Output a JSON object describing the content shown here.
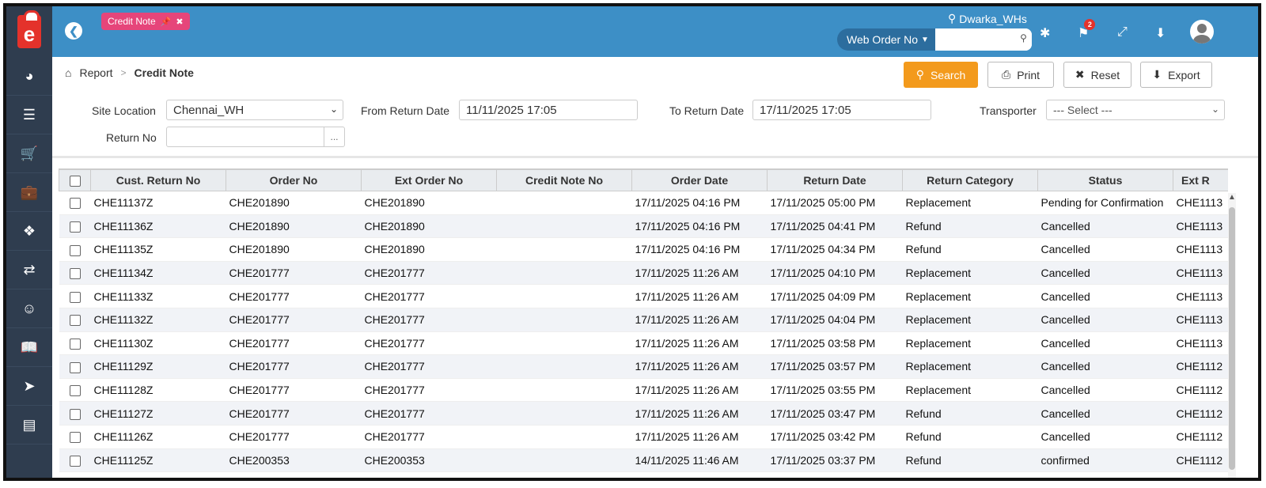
{
  "header": {
    "tab_label": "Credit Note",
    "location": "Dwarka_WHs",
    "search_type": "Web Order No",
    "search_placeholder": "",
    "notification_count": "2",
    "logo_letter": "e"
  },
  "breadcrumb": {
    "root": "Report",
    "current": "Credit Note"
  },
  "actions": {
    "search": "Search",
    "print": "Print",
    "reset": "Reset",
    "export": "Export"
  },
  "filters": {
    "site_location_label": "Site Location",
    "site_location_value": "Chennai_WH",
    "from_date_label": "From Return Date",
    "from_date_value": "11/11/2025 17:05",
    "to_date_label": "To Return Date",
    "to_date_value": "17/11/2025 17:05",
    "transporter_label": "Transporter",
    "transporter_value": "--- Select ---",
    "return_no_label": "Return No",
    "return_no_value": "",
    "return_no_button": "..."
  },
  "table": {
    "columns": [
      "Cust. Return No",
      "Order No",
      "Ext Order No",
      "Credit Note No",
      "Order Date",
      "Return Date",
      "Return Category",
      "Status",
      "Ext R"
    ],
    "rows": [
      [
        "CHE11137Z",
        "CHE201890",
        "CHE201890",
        "",
        "17/11/2025 04:16 PM",
        "17/11/2025 05:00 PM",
        "Replacement",
        "Pending for Confirmation",
        "CHE1113"
      ],
      [
        "CHE11136Z",
        "CHE201890",
        "CHE201890",
        "",
        "17/11/2025 04:16 PM",
        "17/11/2025 04:41 PM",
        "Refund",
        "Cancelled",
        "CHE1113"
      ],
      [
        "CHE11135Z",
        "CHE201890",
        "CHE201890",
        "",
        "17/11/2025 04:16 PM",
        "17/11/2025 04:34 PM",
        "Refund",
        "Cancelled",
        "CHE1113"
      ],
      [
        "CHE11134Z",
        "CHE201777",
        "CHE201777",
        "",
        "17/11/2025 11:26 AM",
        "17/11/2025 04:10 PM",
        "Replacement",
        "Cancelled",
        "CHE1113"
      ],
      [
        "CHE11133Z",
        "CHE201777",
        "CHE201777",
        "",
        "17/11/2025 11:26 AM",
        "17/11/2025 04:09 PM",
        "Replacement",
        "Cancelled",
        "CHE1113"
      ],
      [
        "CHE11132Z",
        "CHE201777",
        "CHE201777",
        "",
        "17/11/2025 11:26 AM",
        "17/11/2025 04:04 PM",
        "Replacement",
        "Cancelled",
        "CHE1113"
      ],
      [
        "CHE11130Z",
        "CHE201777",
        "CHE201777",
        "",
        "17/11/2025 11:26 AM",
        "17/11/2025 03:58 PM",
        "Replacement",
        "Cancelled",
        "CHE1113"
      ],
      [
        "CHE11129Z",
        "CHE201777",
        "CHE201777",
        "",
        "17/11/2025 11:26 AM",
        "17/11/2025 03:57 PM",
        "Replacement",
        "Cancelled",
        "CHE1112"
      ],
      [
        "CHE11128Z",
        "CHE201777",
        "CHE201777",
        "",
        "17/11/2025 11:26 AM",
        "17/11/2025 03:55 PM",
        "Replacement",
        "Cancelled",
        "CHE1112"
      ],
      [
        "CHE11127Z",
        "CHE201777",
        "CHE201777",
        "",
        "17/11/2025 11:26 AM",
        "17/11/2025 03:47 PM",
        "Refund",
        "Cancelled",
        "CHE1112"
      ],
      [
        "CHE11126Z",
        "CHE201777",
        "CHE201777",
        "",
        "17/11/2025 11:26 AM",
        "17/11/2025 03:42 PM",
        "Refund",
        "Cancelled",
        "CHE1112"
      ],
      [
        "CHE11125Z",
        "CHE200353",
        "CHE200353",
        "",
        "14/11/2025 11:46 AM",
        "17/11/2025 03:37 PM",
        "Refund",
        "confirmed",
        "CHE1112"
      ]
    ]
  }
}
